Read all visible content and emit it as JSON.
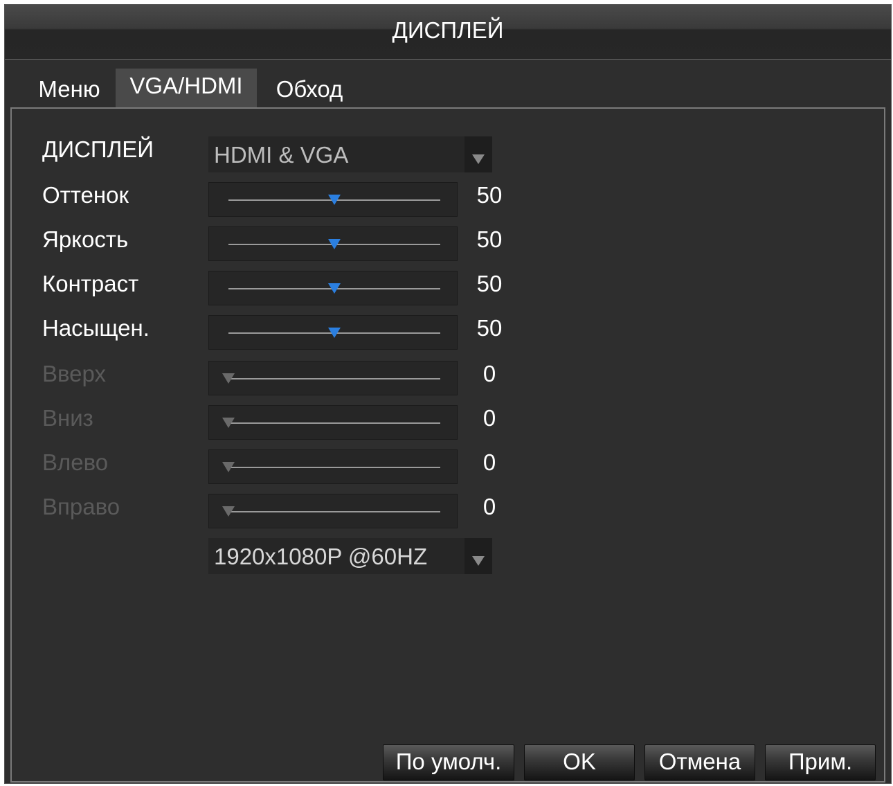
{
  "window": {
    "title": "ДИСПЛЕЙ"
  },
  "tabs": [
    {
      "label": "Меню"
    },
    {
      "label": "VGA/HDMI",
      "active": true
    },
    {
      "label": "Обход"
    }
  ],
  "display": {
    "label": "ДИСПЛЕЙ",
    "value": "HDMI & VGA"
  },
  "sliders": [
    {
      "label": "Оттенок",
      "value": "50",
      "level_percent": 50,
      "enabled": true
    },
    {
      "label": "Яркость",
      "value": "50",
      "level_percent": 50,
      "enabled": true
    },
    {
      "label": "Контраст",
      "value": "50",
      "level_percent": 50,
      "enabled": true
    },
    {
      "label": "Насыщен.",
      "value": "50",
      "level_percent": 50,
      "enabled": true
    },
    {
      "label": "Вверх",
      "value": "0",
      "level_percent": 0,
      "enabled": false
    },
    {
      "label": "Вниз",
      "value": "0",
      "level_percent": 0,
      "enabled": false
    },
    {
      "label": "Влево",
      "value": "0",
      "level_percent": 0,
      "enabled": false
    },
    {
      "label": "Вправо",
      "value": "0",
      "level_percent": 0,
      "enabled": false
    }
  ],
  "resolution": {
    "value": "1920x1080P @60HZ"
  },
  "buttons": {
    "default": "По умолч.",
    "ok": "OK",
    "cancel": "Отмена",
    "apply": "Прим."
  },
  "colors": {
    "thumb_active": "#2b7fe0",
    "thumb_disabled": "#6a6a6a",
    "label_disabled": "#5a5a5a"
  }
}
